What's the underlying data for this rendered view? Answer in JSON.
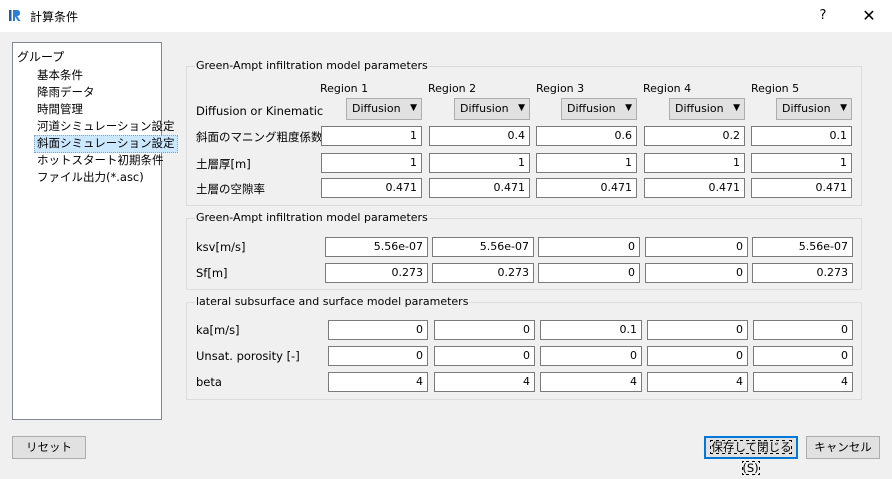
{
  "window": {
    "title": "計算条件",
    "help": "?",
    "close": "✕"
  },
  "sidebar": {
    "header": "グループ",
    "items": [
      {
        "label": "基本条件"
      },
      {
        "label": "降雨データ"
      },
      {
        "label": "時間管理"
      },
      {
        "label": "河道シミュレーション設定"
      },
      {
        "label": "斜面シミュレーション設定",
        "selected": true
      },
      {
        "label": "ホットスタート初期条件"
      },
      {
        "label": "ファイル出力(*.asc)"
      }
    ]
  },
  "group1": {
    "legend": "Green-Ampt infiltration model parameters",
    "regions": [
      "Region 1",
      "Region 2",
      "Region 3",
      "Region 4",
      "Region 5"
    ],
    "diffusion_label": "Diffusion or Kinematic",
    "diffusion_values": [
      "Diffusion",
      "Diffusion",
      "Diffusion",
      "Diffusion",
      "Diffusion"
    ],
    "rows": [
      {
        "label": "斜面のマニング粗度係数",
        "values": [
          "1",
          "0.4",
          "0.6",
          "0.2",
          "0.1"
        ]
      },
      {
        "label": "土層厚[m]",
        "values": [
          "1",
          "1",
          "1",
          "1",
          "1"
        ]
      },
      {
        "label": "土層の空隙率",
        "values": [
          "0.471",
          "0.471",
          "0.471",
          "0.471",
          "0.471"
        ]
      }
    ]
  },
  "group2": {
    "legend": "Green-Ampt infiltration model parameters",
    "rows": [
      {
        "label": "ksv[m/s]",
        "values": [
          "5.56e-07",
          "5.56e-07",
          "0",
          "0",
          "5.56e-07"
        ]
      },
      {
        "label": "Sf[m]",
        "values": [
          "0.273",
          "0.273",
          "0",
          "0",
          "0.273"
        ]
      }
    ]
  },
  "group3": {
    "legend": "lateral subsurface and surface model parameters",
    "rows": [
      {
        "label": "ka[m/s]",
        "values": [
          "0",
          "0",
          "0.1",
          "0",
          "0"
        ]
      },
      {
        "label": "Unsat. porosity [-]",
        "values": [
          "0",
          "0",
          "0",
          "0",
          "0"
        ]
      },
      {
        "label": "beta",
        "values": [
          "4",
          "4",
          "4",
          "4",
          "4"
        ]
      }
    ]
  },
  "buttons": {
    "reset": "リセット",
    "save_close": "保存して閉じる(S)",
    "cancel": "キャンセル"
  },
  "colors": {
    "selection": "#cce8ff",
    "default_button_border": "#0078d7"
  }
}
